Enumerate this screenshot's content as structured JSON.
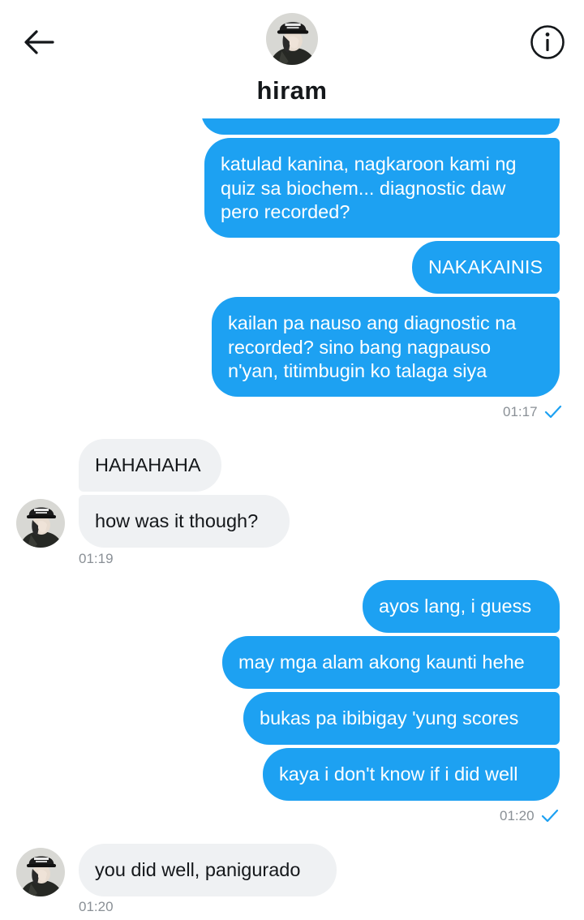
{
  "header": {
    "title": "hiram",
    "back_icon": "arrow-left-icon",
    "info_icon": "info-circle-icon",
    "avatar_icon": "contact-avatar"
  },
  "colors": {
    "accent": "#1da1f2",
    "incoming_bubble": "#eff1f3",
    "timestamp": "#8a9096"
  },
  "messages": {
    "out1": "katulad kanina, nagkaroon kami ng quiz sa biochem... diagnostic daw pero recorded?",
    "out2": "NAKAKAINIS",
    "out3": "kailan pa nauso ang diagnostic na recorded? sino bang nagpauso n'yan, titimbugin ko talaga siya",
    "stamp1": "01:17",
    "in1": "HAHAHAHA",
    "in2": "how was it though?",
    "stamp2": "01:19",
    "out4": "ayos lang, i guess",
    "out5": "may mga alam akong kaunti hehe",
    "out6": "bukas pa ibibigay 'yung scores",
    "out7": "kaya i don't know if i did well",
    "stamp3": "01:20",
    "in3": "you did well, panigurado",
    "stamp4": "01:20"
  }
}
